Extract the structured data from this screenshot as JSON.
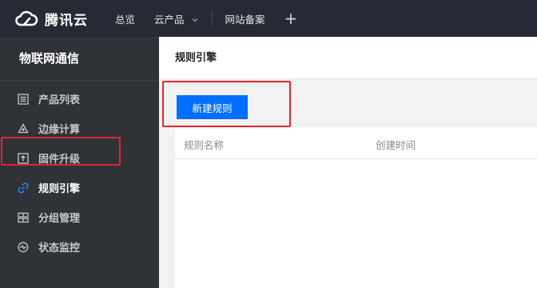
{
  "brand": {
    "name": "腾讯云",
    "logo_icon": "cloud-icon"
  },
  "topnav": {
    "overview": "总览",
    "products": "云产品",
    "icp": "网站备案",
    "plus": "+"
  },
  "sidebar": {
    "title": "物联网通信",
    "items": [
      {
        "label": "产品列表",
        "icon": "list-icon"
      },
      {
        "label": "边缘计算",
        "icon": "edge-computing-icon"
      },
      {
        "label": "固件升级",
        "icon": "upload-icon"
      },
      {
        "label": "规则引擎",
        "icon": "link-icon",
        "active": true
      },
      {
        "label": "分组管理",
        "icon": "group-icon"
      },
      {
        "label": "状态监控",
        "icon": "monitor-icon"
      }
    ]
  },
  "main": {
    "title": "规则引擎",
    "new_rule_button": "新建规则",
    "table": {
      "columns": [
        "规则名称",
        "创建时间"
      ]
    }
  },
  "colors": {
    "topbar": "#262a35",
    "sidebar": "#2f3236",
    "accent": "#006eff",
    "highlight": "#e5232b"
  }
}
